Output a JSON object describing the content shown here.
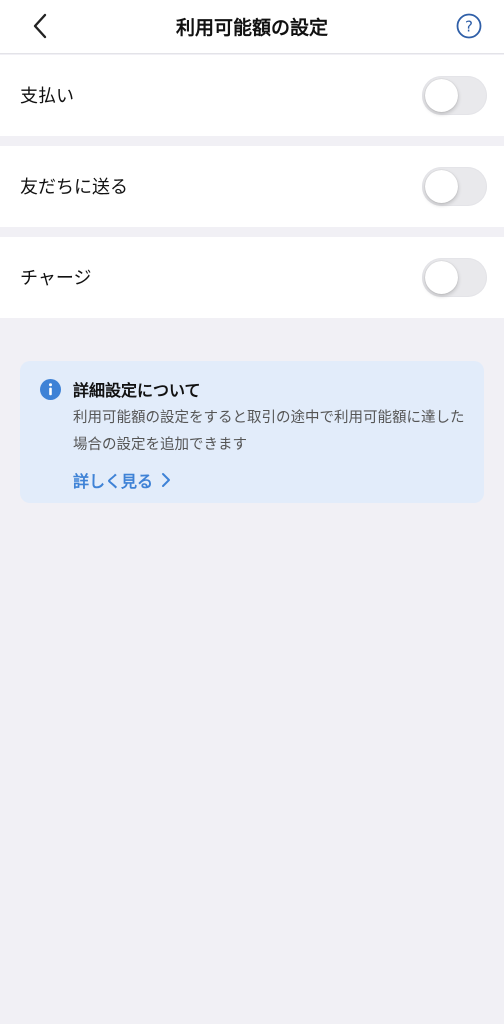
{
  "header": {
    "title": "利用可能額の設定",
    "back_icon": "chevron-left-icon",
    "help_icon": "question-circle-icon"
  },
  "settings": [
    {
      "label": "支払い",
      "enabled": false
    },
    {
      "label": "友だちに送る",
      "enabled": false
    },
    {
      "label": "チャージ",
      "enabled": false
    }
  ],
  "info": {
    "title": "詳細設定について",
    "body": "利用可能額の設定をすると取引の途中で利用可能額に達した場合の設定を追加できます",
    "link_label": "詳しく見る",
    "icon": "info-icon",
    "accent_color": "#3e82d6"
  },
  "colors": {
    "background": "#f1f0f5",
    "card": "#e2ecfa",
    "toggle_off": "#e9e9ec"
  }
}
